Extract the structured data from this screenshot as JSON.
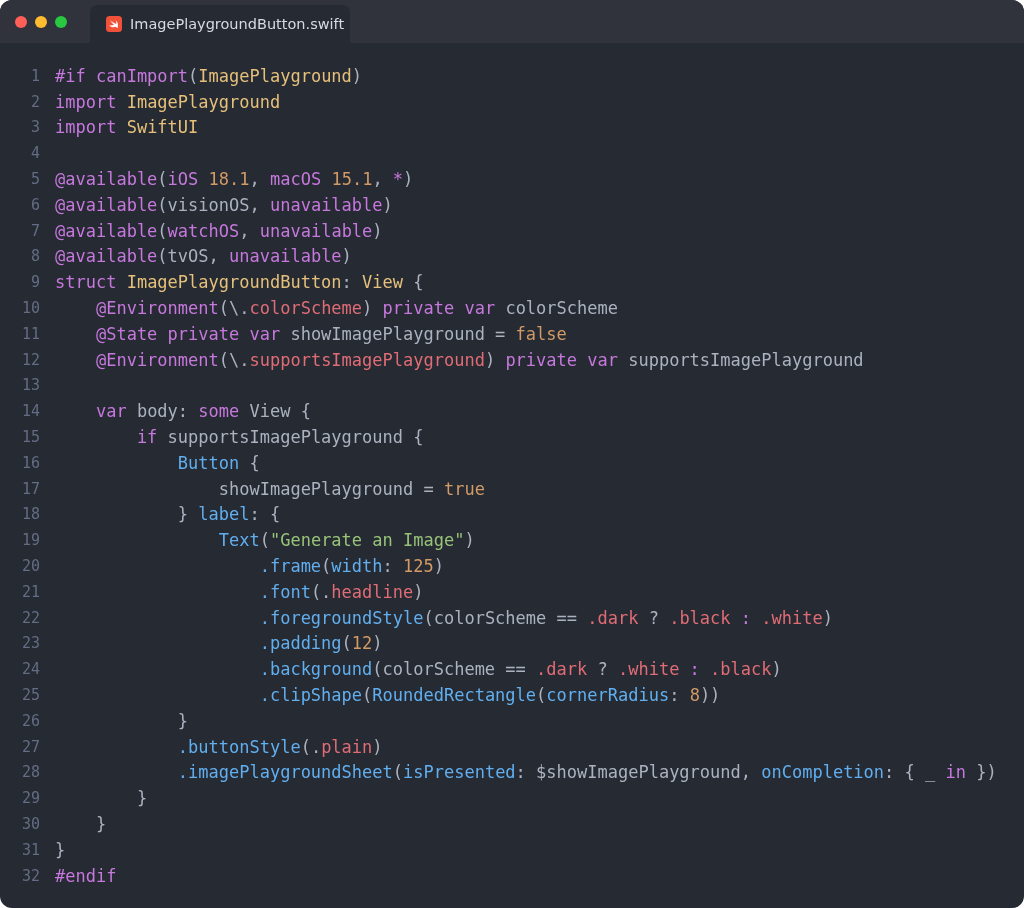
{
  "tab": {
    "title": "ImagePlaygroundButton.swift",
    "selected": true
  },
  "lines": [
    {
      "number": "1",
      "tokens": [
        {
          "kind": "k",
          "text": "#if canImport"
        },
        {
          "kind": "x",
          "text": "("
        },
        {
          "kind": "t",
          "text": "ImagePlayground"
        },
        {
          "kind": "x",
          "text": ")"
        }
      ]
    },
    {
      "number": "2",
      "tokens": [
        {
          "kind": "k",
          "text": "import "
        },
        {
          "kind": "t",
          "text": "ImagePlayground"
        }
      ]
    },
    {
      "number": "3",
      "tokens": [
        {
          "kind": "k",
          "text": "import "
        },
        {
          "kind": "t",
          "text": "SwiftUI"
        }
      ]
    },
    {
      "number": "4"
    },
    {
      "number": "5",
      "tokens": [
        {
          "kind": "k",
          "text": "@available"
        },
        {
          "kind": "x",
          "text": "("
        },
        {
          "kind": "k",
          "text": "iOS "
        },
        {
          "kind": "n",
          "text": "18.1"
        },
        {
          "kind": "x",
          "text": ", "
        },
        {
          "kind": "k",
          "text": "macOS "
        },
        {
          "kind": "n",
          "text": "15.1"
        },
        {
          "kind": "x",
          "text": ", "
        },
        {
          "kind": "k",
          "text": "*"
        },
        {
          "kind": "x",
          "text": ")"
        }
      ]
    },
    {
      "number": "6",
      "tokens": [
        {
          "kind": "k",
          "text": "@available"
        },
        {
          "kind": "x",
          "text": "(visionOS, "
        },
        {
          "kind": "k",
          "text": "unavailable"
        },
        {
          "kind": "x",
          "text": ")"
        }
      ]
    },
    {
      "number": "7",
      "tokens": [
        {
          "kind": "k",
          "text": "@available"
        },
        {
          "kind": "x",
          "text": "("
        },
        {
          "kind": "k",
          "text": "watchOS"
        },
        {
          "kind": "x",
          "text": ", "
        },
        {
          "kind": "k",
          "text": "unavailable"
        },
        {
          "kind": "x",
          "text": ")"
        }
      ]
    },
    {
      "number": "8",
      "tokens": [
        {
          "kind": "k",
          "text": "@available"
        },
        {
          "kind": "x",
          "text": "(tvOS, "
        },
        {
          "kind": "k",
          "text": "unavailable"
        },
        {
          "kind": "x",
          "text": ")"
        }
      ]
    },
    {
      "number": "9",
      "tokens": [
        {
          "kind": "k",
          "text": "struct "
        },
        {
          "kind": "t",
          "text": "ImagePlaygroundButton"
        },
        {
          "kind": "x",
          "text": ": "
        },
        {
          "kind": "t",
          "text": "View"
        },
        {
          "kind": "x",
          "text": " {"
        }
      ]
    },
    {
      "number": "10",
      "tokens": [
        {
          "kind": "k",
          "text": "    @Environment"
        },
        {
          "kind": "x",
          "text": "(\\."
        },
        {
          "kind": "p",
          "text": "colorScheme"
        },
        {
          "kind": "x",
          "text": ") "
        },
        {
          "kind": "k",
          "text": "private var "
        },
        {
          "kind": "x",
          "text": "colorScheme"
        }
      ]
    },
    {
      "number": "11",
      "tokens": [
        {
          "kind": "k",
          "text": "    @State private var "
        },
        {
          "kind": "x",
          "text": "showImagePlayground = "
        },
        {
          "kind": "n",
          "text": "false"
        }
      ]
    },
    {
      "number": "12",
      "tokens": [
        {
          "kind": "k",
          "text": "    @Environment"
        },
        {
          "kind": "x",
          "text": "(\\."
        },
        {
          "kind": "p",
          "text": "supportsImagePlayground"
        },
        {
          "kind": "x",
          "text": ") "
        },
        {
          "kind": "k",
          "text": "private var "
        },
        {
          "kind": "x",
          "text": "supportsImagePlayground"
        }
      ]
    },
    {
      "number": "13"
    },
    {
      "number": "14",
      "tokens": [
        {
          "kind": "k",
          "text": "    var "
        },
        {
          "kind": "x",
          "text": "body: "
        },
        {
          "kind": "k",
          "text": "some "
        },
        {
          "kind": "x",
          "text": "View {"
        }
      ]
    },
    {
      "number": "15",
      "tokens": [
        {
          "kind": "k",
          "text": "        if "
        },
        {
          "kind": "x",
          "text": "supportsImagePlayground {"
        }
      ]
    },
    {
      "number": "16",
      "tokens": [
        {
          "kind": "f",
          "text": "            Button"
        },
        {
          "kind": "x",
          "text": " {"
        }
      ]
    },
    {
      "number": "17",
      "tokens": [
        {
          "kind": "x",
          "text": "                showImagePlayground = "
        },
        {
          "kind": "n",
          "text": "true"
        }
      ]
    },
    {
      "number": "18",
      "tokens": [
        {
          "kind": "x",
          "text": "            } "
        },
        {
          "kind": "f",
          "text": "label"
        },
        {
          "kind": "x",
          "text": ": {"
        }
      ]
    },
    {
      "number": "19",
      "tokens": [
        {
          "kind": "f",
          "text": "                Text"
        },
        {
          "kind": "x",
          "text": "("
        },
        {
          "kind": "s",
          "text": "\"Generate an Image\""
        },
        {
          "kind": "x",
          "text": ")"
        }
      ]
    },
    {
      "number": "20",
      "tokens": [
        {
          "kind": "f",
          "text": "                    .frame"
        },
        {
          "kind": "x",
          "text": "("
        },
        {
          "kind": "f",
          "text": "width"
        },
        {
          "kind": "x",
          "text": ": "
        },
        {
          "kind": "n",
          "text": "125"
        },
        {
          "kind": "x",
          "text": ")"
        }
      ]
    },
    {
      "number": "21",
      "tokens": [
        {
          "kind": "f",
          "text": "                    .font"
        },
        {
          "kind": "x",
          "text": "(."
        },
        {
          "kind": "p",
          "text": "headline"
        },
        {
          "kind": "x",
          "text": ")"
        }
      ]
    },
    {
      "number": "22",
      "tokens": [
        {
          "kind": "f",
          "text": "                    .foregroundStyle"
        },
        {
          "kind": "x",
          "text": "(colorScheme == "
        },
        {
          "kind": "p",
          "text": ".dark"
        },
        {
          "kind": "x",
          "text": " ? "
        },
        {
          "kind": "p",
          "text": ".black"
        },
        {
          "kind": "k",
          "text": " : "
        },
        {
          "kind": "p",
          "text": ".white"
        },
        {
          "kind": "x",
          "text": ")"
        }
      ]
    },
    {
      "number": "23",
      "tokens": [
        {
          "kind": "f",
          "text": "                    .padding"
        },
        {
          "kind": "x",
          "text": "("
        },
        {
          "kind": "n",
          "text": "12"
        },
        {
          "kind": "x",
          "text": ")"
        }
      ]
    },
    {
      "number": "24",
      "tokens": [
        {
          "kind": "f",
          "text": "                    .background"
        },
        {
          "kind": "x",
          "text": "(colorScheme == "
        },
        {
          "kind": "p",
          "text": ".dark"
        },
        {
          "kind": "x",
          "text": " ? "
        },
        {
          "kind": "p",
          "text": ".white"
        },
        {
          "kind": "k",
          "text": " : "
        },
        {
          "kind": "p",
          "text": ".black"
        },
        {
          "kind": "x",
          "text": ")"
        }
      ]
    },
    {
      "number": "25",
      "tokens": [
        {
          "kind": "f",
          "text": "                    .clipShape"
        },
        {
          "kind": "x",
          "text": "("
        },
        {
          "kind": "f",
          "text": "RoundedRectangle"
        },
        {
          "kind": "x",
          "text": "("
        },
        {
          "kind": "f",
          "text": "cornerRadius"
        },
        {
          "kind": "x",
          "text": ": "
        },
        {
          "kind": "n",
          "text": "8"
        },
        {
          "kind": "x",
          "text": "))"
        }
      ]
    },
    {
      "number": "26",
      "tokens": [
        {
          "kind": "x",
          "text": "            }"
        }
      ]
    },
    {
      "number": "27",
      "tokens": [
        {
          "kind": "f",
          "text": "            .buttonStyle"
        },
        {
          "kind": "x",
          "text": "(."
        },
        {
          "kind": "p",
          "text": "plain"
        },
        {
          "kind": "x",
          "text": ")"
        }
      ]
    },
    {
      "number": "28",
      "tokens": [
        {
          "kind": "f",
          "text": "            .imagePlaygroundSheet"
        },
        {
          "kind": "x",
          "text": "("
        },
        {
          "kind": "f",
          "text": "isPresented"
        },
        {
          "kind": "x",
          "text": ": $showImagePlayground, "
        },
        {
          "kind": "f",
          "text": "onCompletion"
        },
        {
          "kind": "x",
          "text": ": { _ "
        },
        {
          "kind": "k",
          "text": "in"
        },
        {
          "kind": "x",
          "text": " })"
        }
      ]
    },
    {
      "number": "29",
      "tokens": [
        {
          "kind": "x",
          "text": "        }"
        }
      ]
    },
    {
      "number": "30",
      "tokens": [
        {
          "kind": "x",
          "text": "    }"
        }
      ]
    },
    {
      "number": "31",
      "tokens": [
        {
          "kind": "x",
          "text": "}"
        }
      ]
    },
    {
      "number": "32",
      "tokens": [
        {
          "kind": "k",
          "text": "#endif"
        }
      ]
    }
  ]
}
